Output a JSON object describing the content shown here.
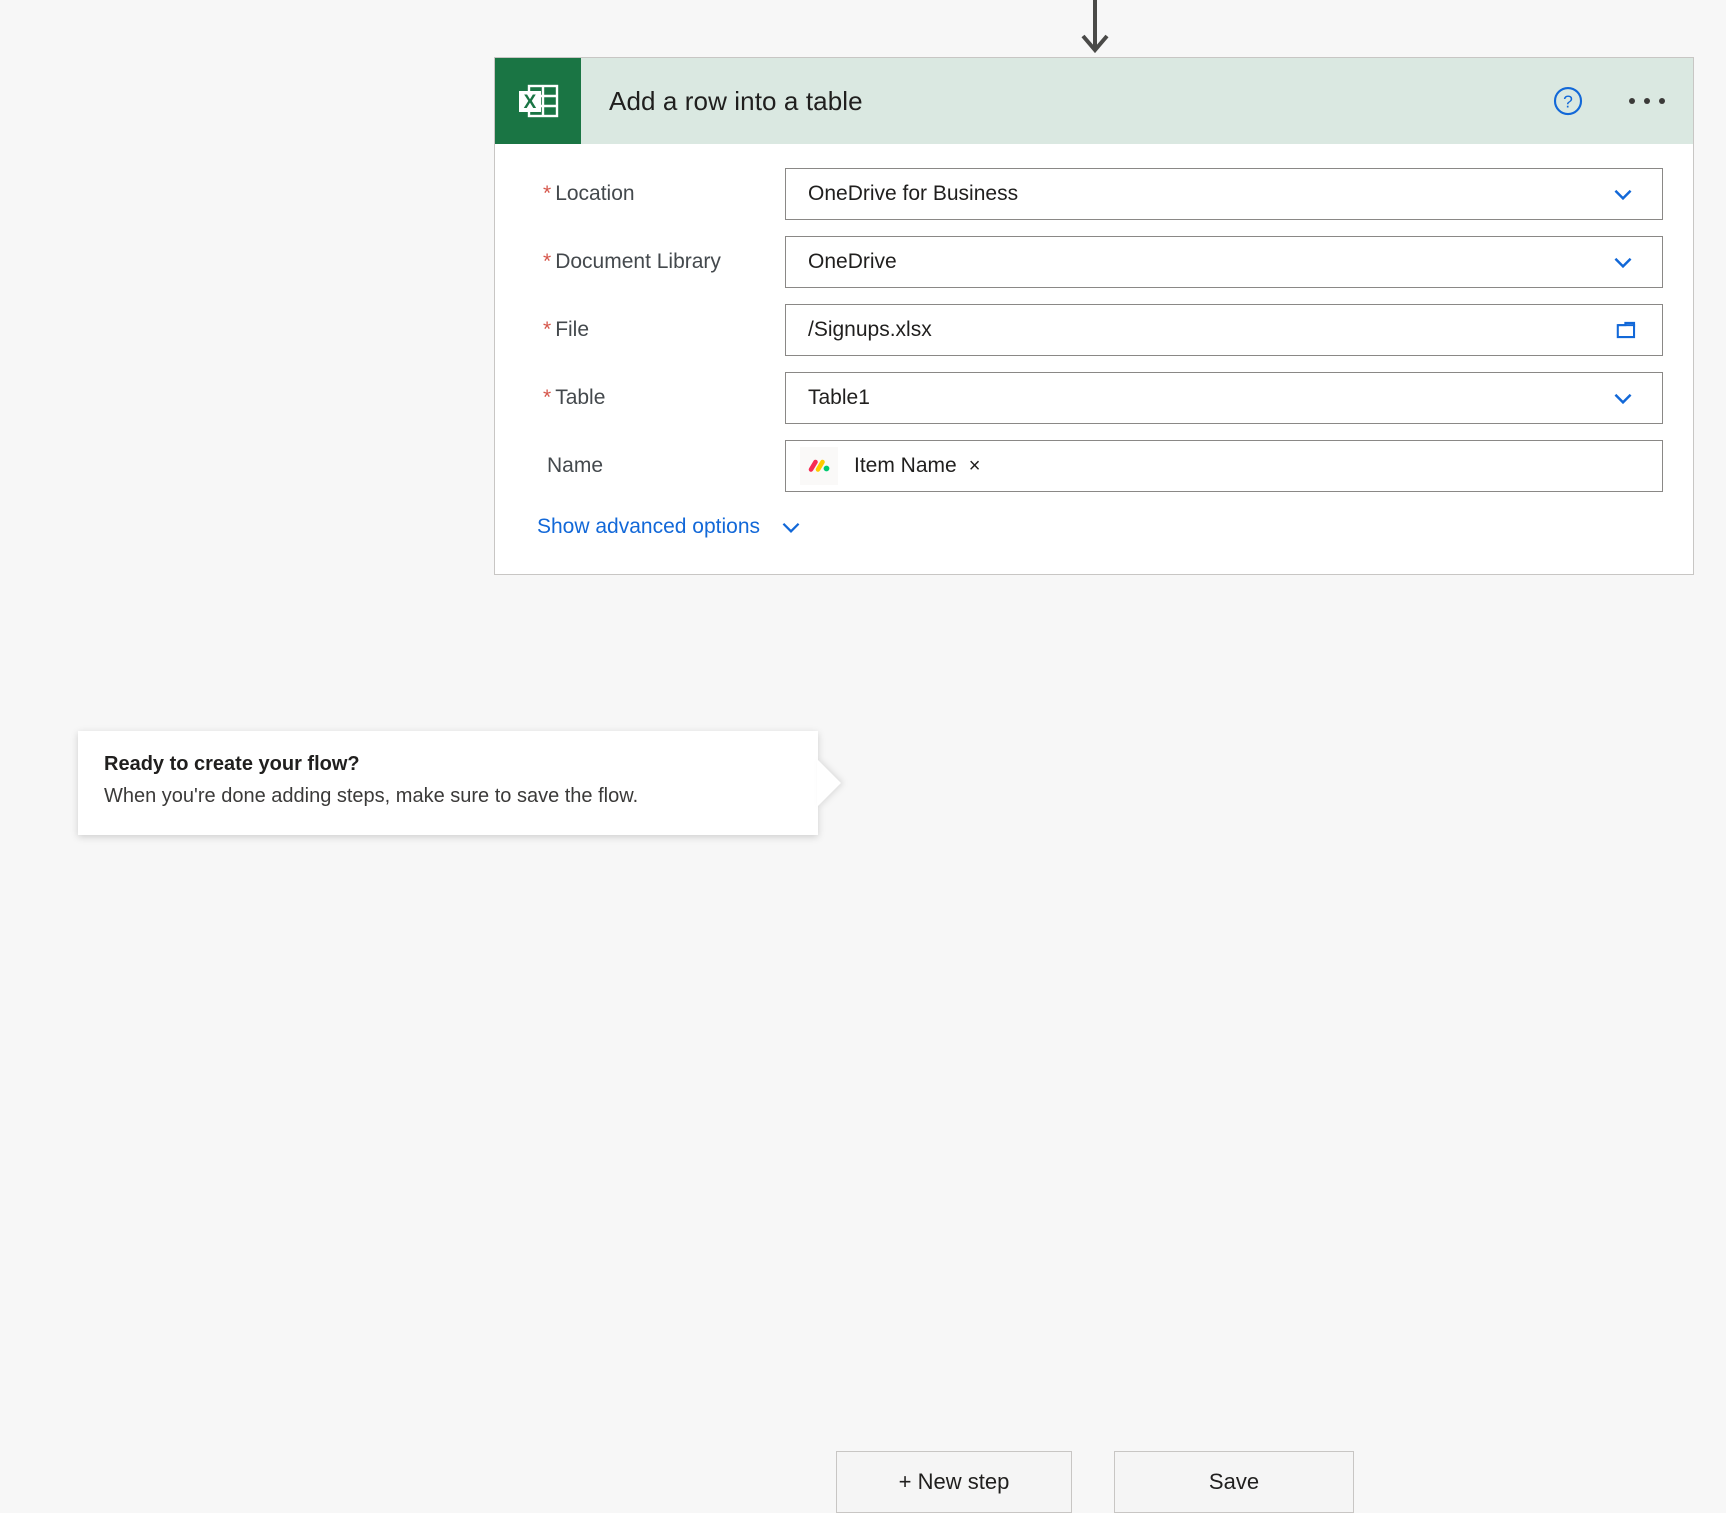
{
  "canvas": {
    "background_color": "#f7f7f7",
    "connector_arrow": "arrow-down-icon"
  },
  "action_card": {
    "title": "Add a row into a table",
    "connector_icon": "excel-icon",
    "header_color": "#dae8e1",
    "icon_tile_color": "#1a7544",
    "help_icon": "help-circle-icon",
    "more_menu_icon": "ellipsis-icon",
    "fields": [
      {
        "label": "Location",
        "required": true,
        "required_marker": "*",
        "value": "OneDrive for Business",
        "control": "dropdown",
        "trailing_icon": "chevron-down-icon"
      },
      {
        "label": "Document Library",
        "required": true,
        "required_marker": "*",
        "value": "OneDrive",
        "control": "dropdown",
        "trailing_icon": "chevron-down-icon"
      },
      {
        "label": "File",
        "required": true,
        "required_marker": "*",
        "value": "/Signups.xlsx",
        "control": "file-picker",
        "trailing_icon": "folder-icon"
      },
      {
        "label": "Table",
        "required": true,
        "required_marker": "*",
        "value": "Table1",
        "control": "dropdown",
        "trailing_icon": "chevron-down-icon"
      },
      {
        "label": "Name",
        "required": false,
        "required_marker": "",
        "value": "",
        "control": "token-input",
        "token": {
          "icon": "monday-icon",
          "label": "Item Name",
          "remove_glyph": "×"
        }
      }
    ],
    "advanced_options": {
      "label": "Show advanced options",
      "icon": "chevron-down-icon"
    }
  },
  "callout": {
    "title": "Ready to create your flow?",
    "body": "When you're done adding steps, make sure to save the flow."
  },
  "bottom_bar": {
    "new_step_label": "+ New step",
    "save_label": "Save"
  },
  "colors": {
    "accent_blue": "#1268d8",
    "required_red": "#d6564b",
    "excel_green": "#1a7544",
    "header_green": "#dae8e1",
    "border_gray": "#8a8886"
  }
}
